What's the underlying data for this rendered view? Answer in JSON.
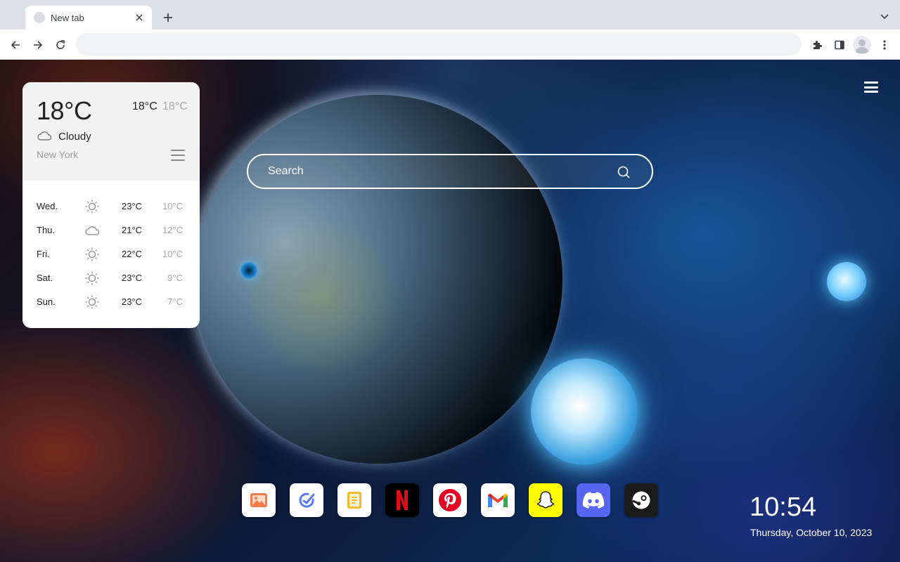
{
  "browser": {
    "tab": {
      "title": "New tab"
    },
    "omnibox": {
      "value": "",
      "placeholder": ""
    }
  },
  "weather": {
    "current_temp": "18°C",
    "high": "18°C",
    "low": "18°C",
    "condition": "Cloudy",
    "condition_icon": "cloud-icon",
    "city": "New York",
    "forecast": [
      {
        "day": "Wed.",
        "icon": "sun-icon",
        "high": "23°C",
        "low": "10°C"
      },
      {
        "day": "Thu.",
        "icon": "cloud-icon",
        "high": "21°C",
        "low": "12°C"
      },
      {
        "day": "Fri.",
        "icon": "sun-icon",
        "high": "22°C",
        "low": "10°C"
      },
      {
        "day": "Sat.",
        "icon": "sun-icon",
        "high": "23°C",
        "low": "9°C"
      },
      {
        "day": "Sun.",
        "icon": "sun-icon",
        "high": "23°C",
        "low": "7°C"
      }
    ]
  },
  "search": {
    "placeholder": "Search",
    "value": ""
  },
  "dock": {
    "apps": [
      {
        "name": "photos",
        "icon": "photo-icon",
        "color": "#ffffff"
      },
      {
        "name": "tasks",
        "icon": "check-circle-icon",
        "color": "#ffffff"
      },
      {
        "name": "notes",
        "icon": "note-icon",
        "color": "#ffffff"
      },
      {
        "name": "netflix",
        "icon": "netflix-icon",
        "color": "#000000"
      },
      {
        "name": "pinterest",
        "icon": "pinterest-icon",
        "color": "#ffffff"
      },
      {
        "name": "gmail",
        "icon": "gmail-icon",
        "color": "#ffffff"
      },
      {
        "name": "snapchat",
        "icon": "snapchat-icon",
        "color": "#fffc00"
      },
      {
        "name": "discord",
        "icon": "discord-icon",
        "color": "#5865f2"
      },
      {
        "name": "steam",
        "icon": "steam-icon",
        "color": "#1b1b1b"
      }
    ]
  },
  "clock": {
    "time": "10:54",
    "date": "Thursday, October 10, 2023"
  }
}
